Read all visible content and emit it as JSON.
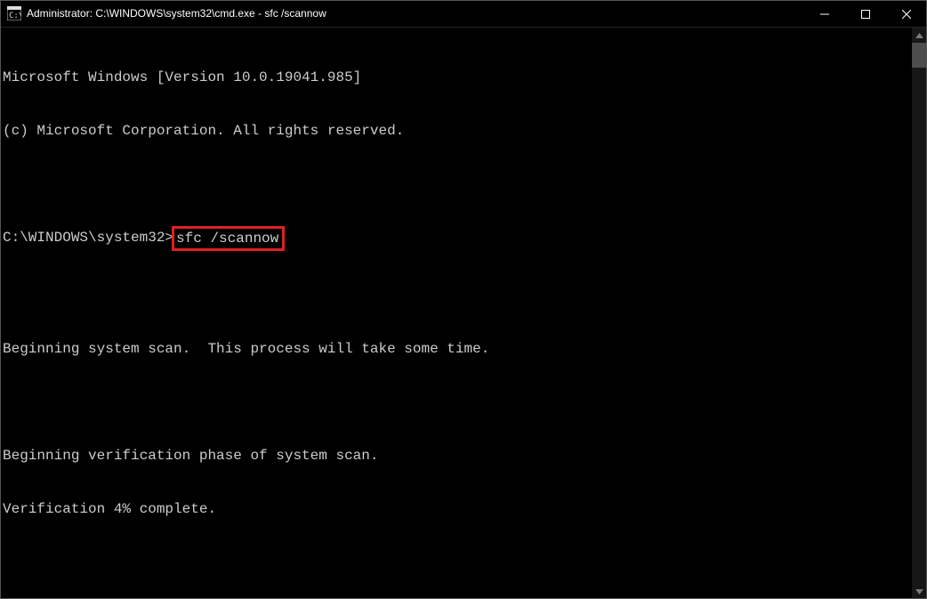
{
  "window": {
    "title": "Administrator: C:\\WINDOWS\\system32\\cmd.exe - sfc  /scannow"
  },
  "terminal": {
    "line1": "Microsoft Windows [Version 10.0.19041.985]",
    "line2": "(c) Microsoft Corporation. All rights reserved.",
    "prompt": "C:\\WINDOWS\\system32>",
    "command": "sfc /scannow",
    "line_scan": "Beginning system scan.  This process will take some time.",
    "line_verif": "Beginning verification phase of system scan.",
    "line_pct": "Verification 4% complete."
  }
}
